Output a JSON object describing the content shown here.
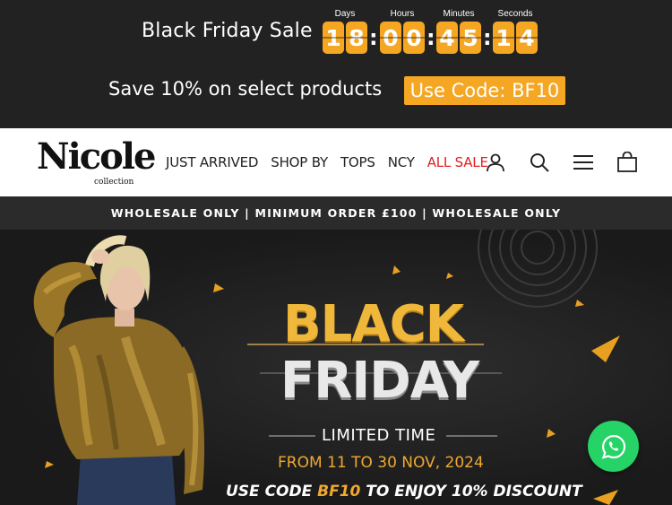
{
  "promo": {
    "title": "Black Friday Sale",
    "countdown": {
      "days": {
        "label": "Days",
        "digits": [
          "1",
          "8"
        ]
      },
      "hours": {
        "label": "Hours",
        "digits": [
          "0",
          "0"
        ]
      },
      "minutes": {
        "label": "Minutes",
        "digits": [
          "4",
          "5"
        ]
      },
      "seconds": {
        "label": "Seconds",
        "digits": [
          "1",
          "4"
        ]
      },
      "separator": ":"
    },
    "save_text": "Save 10% on select products",
    "code_text": "Use Code: BF10"
  },
  "header": {
    "logo_main": "Nicole",
    "logo_sub": "collection",
    "nav": [
      "JUST ARRIVED",
      "SHOP BY",
      "TOPS",
      "NCY",
      "ALL SALE"
    ]
  },
  "announcement": "WHOLESALE ONLY | MINIMUM ORDER £100 | WHOLESALE ONLY",
  "hero": {
    "line1": "BLACK",
    "line2": "FRIDAY",
    "limited": "LIMITED TIME",
    "dates": "FROM 11 TO 30 NOV, 2024",
    "code_pre": "USE CODE ",
    "code": "BF10",
    "code_post": " TO ENJOY 10% DISCOUNT"
  },
  "colors": {
    "accent": "#f5a623",
    "sale_red": "#e02020",
    "whatsapp": "#25d366"
  },
  "icons": [
    "account-icon",
    "search-icon",
    "menu-icon",
    "cart-icon",
    "whatsapp-icon"
  ]
}
